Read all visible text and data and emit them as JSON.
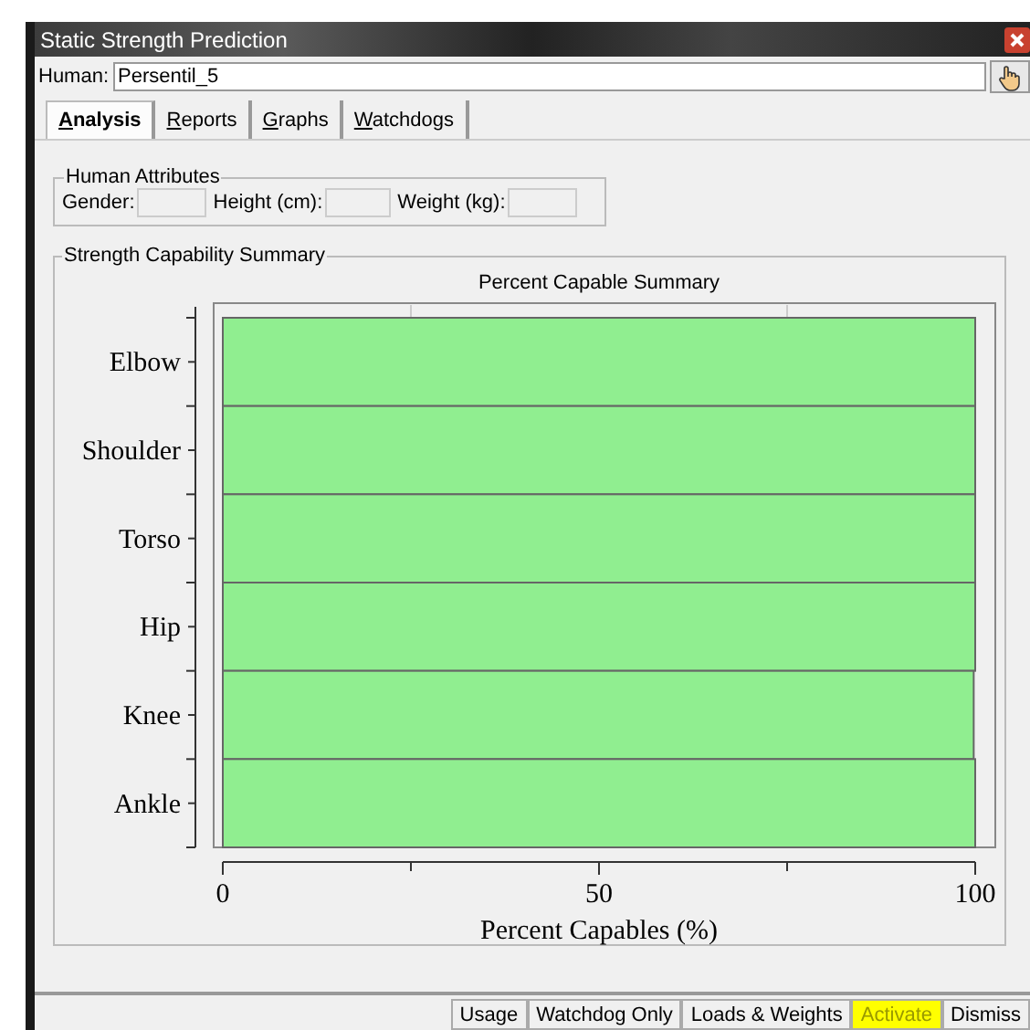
{
  "window": {
    "title": "Static Strength Prediction"
  },
  "human": {
    "label": "Human:",
    "value": "Persentil_5"
  },
  "tabs": [
    {
      "label": "Analysis",
      "selected": true
    },
    {
      "label": "Reports",
      "selected": false
    },
    {
      "label": "Graphs",
      "selected": false
    },
    {
      "label": "Watchdogs",
      "selected": false
    }
  ],
  "human_attributes": {
    "title": "Human Attributes",
    "fields": [
      {
        "label": "Gender:"
      },
      {
        "label": "Height (cm):"
      },
      {
        "label": "Weight (kg):"
      }
    ]
  },
  "summary": {
    "title": "Strength Capability Summary",
    "chart_data": {
      "type": "bar",
      "orientation": "horizontal",
      "title": "Percent Capable Summary",
      "xlabel": "Percent Capables (%)",
      "categories": [
        "Elbow",
        "Shoulder",
        "Torso",
        "Hip",
        "Knee",
        "Ankle"
      ],
      "series": [
        {
          "color": "#90ee90",
          "values": [
            100,
            100,
            100,
            100,
            99.8,
            100
          ]
        }
      ],
      "xlim": [
        0,
        100
      ],
      "xticks": [
        0,
        50,
        100
      ]
    }
  },
  "buttons": [
    {
      "label": "Usage",
      "highlighted": false
    },
    {
      "label": "Watchdog Only",
      "highlighted": false
    },
    {
      "label": "Loads & Weights",
      "highlighted": false
    },
    {
      "label": "Activate",
      "highlighted": true
    },
    {
      "label": "Dismiss",
      "highlighted": false
    }
  ]
}
